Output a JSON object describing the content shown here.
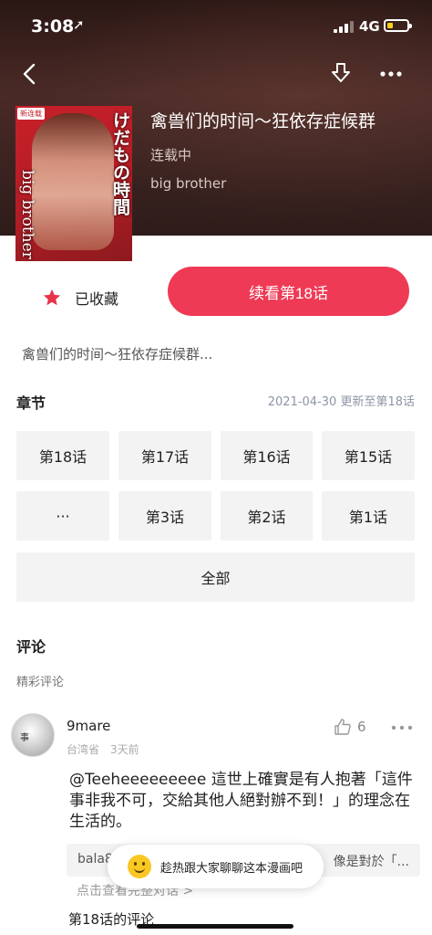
{
  "status_bar": {
    "time": "3:08",
    "network": "4G",
    "battery_level": 0.3,
    "battery_color": "#f7d117"
  },
  "nav": {
    "back_icon": "chevron-left-icon",
    "download_icon": "download-icon",
    "more_icon": "more-icon"
  },
  "comic": {
    "title": "禽兽们的时间～狂依存症候群",
    "status": "连载中",
    "author": "big brother",
    "cover_text_jp": "けだもの時間",
    "cover_text_en": "big brother",
    "cover_tag": "新连载"
  },
  "actions": {
    "favorite_label": "已收藏",
    "favorite_color": "#e8334a",
    "continue_label": "续看第18话",
    "accent": "#ef3a55"
  },
  "description": "禽兽们的时间～狂依存症候群...",
  "chapters": {
    "section_title": "章节",
    "update_text": "2021-04-30 更新至第18话",
    "items": [
      "第18话",
      "第17话",
      "第16话",
      "第15话",
      "···",
      "第3话",
      "第2话",
      "第1话"
    ],
    "all_label": "全部"
  },
  "comments": {
    "section_title": "评论",
    "subsection": "精彩评论",
    "items": [
      {
        "user": "9mare",
        "location": "台湾省",
        "time": "3天前",
        "likes": "6",
        "text": "@Teeheeeeeeeee 這世上確實是有人抱著「這件事非我不可，交給其他人絕對辦不到！」的理念在生活的。",
        "reply_left": "bala8",
        "reply_right": "像是對於「...",
        "view_all": "点击查看完整对话 >"
      }
    ],
    "next_heading": "第18话的评论"
  },
  "toast": {
    "text": "趁热跟大家聊聊这本漫画吧"
  }
}
